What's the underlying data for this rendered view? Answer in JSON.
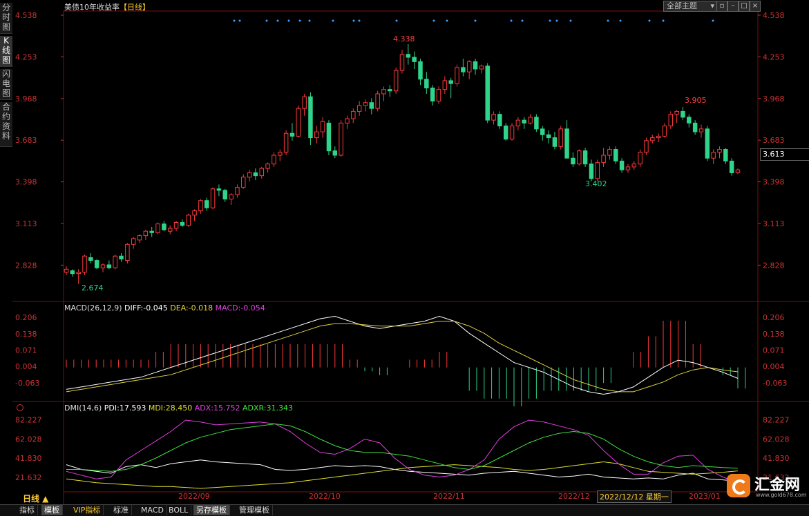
{
  "side_tabs": [
    "分时图",
    "K线图",
    "闪电图",
    "合约资料"
  ],
  "header": {
    "title": "美债10年收益率",
    "period": "【日线】",
    "theme_select": "全部主题"
  },
  "toolbar_icons": [
    "restore-icon",
    "minimize-icon",
    "maximize-icon",
    "close-icon"
  ],
  "price_panel": {
    "ylim": [
      2.674,
      4.538
    ],
    "y_ticks": [
      "4.538",
      "4.253",
      "3.968",
      "3.683",
      "3.398",
      "3.113",
      "2.828"
    ],
    "current_price": "3.613",
    "annotations": {
      "high": "4.338",
      "low": "2.674",
      "local_high": "3.905",
      "local_low": "3.402"
    }
  },
  "macd_panel": {
    "label": "MACD(26,12,9)",
    "diff": "DIFF:-0.045",
    "dea": "DEA:-0.018",
    "macd": "MACD:-0.054",
    "y_ticks": [
      "0.206",
      "0.138",
      "0.071",
      "0.004",
      "-0.063"
    ]
  },
  "dmi_panel": {
    "label": "DMI(14,6)",
    "pdi": "PDI:17.593",
    "mdi": "MDI:28.450",
    "adx": "ADX:15.752",
    "adxr": "ADXR:31.343",
    "y_ticks": [
      "82.227",
      "62.028",
      "41.830",
      "21.632"
    ]
  },
  "x_axis": {
    "period_label": "日线 ▲",
    "month_labels": [
      "2022/09",
      "2022/10",
      "2022/11",
      "2022/12",
      "2023/01"
    ],
    "cursor_date": "2022/12/12 星期一"
  },
  "bottom_tabs": [
    "指标",
    "模板",
    "VIP指标",
    "标准",
    "MACD",
    "BOLL",
    "另存模板",
    "管理模板"
  ],
  "logo": {
    "text": "汇金网",
    "url_text": "www.gold678.com"
  },
  "colors": {
    "up": "#ff3a3a",
    "down": "#2fd48a",
    "axis": "#cc3333",
    "diff": "#ffffff",
    "dea": "#e0d040",
    "pdi": "#ffffff",
    "mdi": "#e0e030",
    "adx": "#e040e0",
    "adxr": "#40e040"
  },
  "chart_data": [
    {
      "type": "candlestick",
      "title": "美债10年收益率",
      "ylim": [
        2.674,
        4.538
      ],
      "ohlc": [
        [
          2.78,
          2.82,
          2.76,
          2.8
        ],
        [
          2.79,
          2.8,
          2.75,
          2.77
        ],
        [
          2.77,
          2.8,
          2.7,
          2.78
        ],
        [
          2.78,
          2.9,
          2.76,
          2.89
        ],
        [
          2.88,
          2.91,
          2.84,
          2.86
        ],
        [
          2.86,
          2.87,
          2.8,
          2.81
        ],
        [
          2.81,
          2.84,
          2.78,
          2.83
        ],
        [
          2.83,
          2.86,
          2.8,
          2.81
        ],
        [
          2.81,
          2.9,
          2.8,
          2.89
        ],
        [
          2.89,
          2.91,
          2.85,
          2.87
        ],
        [
          2.86,
          2.98,
          2.84,
          2.97
        ],
        [
          2.97,
          3.02,
          2.94,
          3.01
        ],
        [
          3.0,
          3.04,
          2.98,
          3.03
        ],
        [
          3.03,
          3.07,
          3.0,
          3.06
        ],
        [
          3.06,
          3.09,
          3.02,
          3.05
        ],
        [
          3.05,
          3.12,
          3.04,
          3.11
        ],
        [
          3.11,
          3.13,
          3.06,
          3.07
        ],
        [
          3.06,
          3.1,
          3.04,
          3.08
        ],
        [
          3.08,
          3.13,
          3.06,
          3.12
        ],
        [
          3.12,
          3.14,
          3.09,
          3.1
        ],
        [
          3.1,
          3.18,
          3.09,
          3.17
        ],
        [
          3.17,
          3.21,
          3.13,
          3.2
        ],
        [
          3.2,
          3.28,
          3.18,
          3.27
        ],
        [
          3.27,
          3.29,
          3.2,
          3.22
        ],
        [
          3.22,
          3.36,
          3.21,
          3.35
        ],
        [
          3.35,
          3.38,
          3.3,
          3.34
        ],
        [
          3.34,
          3.35,
          3.26,
          3.28
        ],
        [
          3.28,
          3.32,
          3.24,
          3.31
        ],
        [
          3.31,
          3.38,
          3.29,
          3.36
        ],
        [
          3.36,
          3.45,
          3.35,
          3.43
        ],
        [
          3.43,
          3.48,
          3.4,
          3.46
        ],
        [
          3.46,
          3.49,
          3.41,
          3.44
        ],
        [
          3.44,
          3.5,
          3.42,
          3.49
        ],
        [
          3.49,
          3.53,
          3.46,
          3.52
        ],
        [
          3.52,
          3.6,
          3.5,
          3.58
        ],
        [
          3.58,
          3.62,
          3.54,
          3.6
        ],
        [
          3.6,
          3.75,
          3.58,
          3.73
        ],
        [
          3.73,
          3.8,
          3.68,
          3.71
        ],
        [
          3.71,
          3.92,
          3.7,
          3.9
        ],
        [
          3.9,
          4.0,
          3.85,
          3.98
        ],
        [
          3.98,
          4.01,
          3.65,
          3.7
        ],
        [
          3.7,
          3.78,
          3.66,
          3.74
        ],
        [
          3.74,
          3.84,
          3.7,
          3.81
        ],
        [
          3.8,
          3.82,
          3.58,
          3.61
        ],
        [
          3.61,
          3.64,
          3.56,
          3.58
        ],
        [
          3.58,
          3.82,
          3.57,
          3.8
        ],
        [
          3.8,
          3.85,
          3.76,
          3.83
        ],
        [
          3.83,
          3.9,
          3.8,
          3.88
        ],
        [
          3.88,
          3.95,
          3.85,
          3.92
        ],
        [
          3.92,
          3.96,
          3.88,
          3.94
        ],
        [
          3.94,
          3.97,
          3.86,
          3.9
        ],
        [
          3.9,
          4.02,
          3.88,
          4.0
        ],
        [
          4.0,
          4.05,
          3.95,
          4.03
        ],
        [
          4.03,
          4.06,
          3.98,
          4.02
        ],
        [
          4.02,
          4.18,
          4.0,
          4.16
        ],
        [
          4.16,
          4.3,
          4.14,
          4.27
        ],
        [
          4.27,
          4.34,
          4.2,
          4.25
        ],
        [
          4.25,
          4.29,
          4.17,
          4.22
        ],
        [
          4.22,
          4.24,
          4.06,
          4.1
        ],
        [
          4.1,
          4.15,
          4.0,
          4.04
        ],
        [
          4.04,
          4.06,
          3.92,
          3.95
        ],
        [
          3.95,
          4.05,
          3.93,
          4.03
        ],
        [
          4.03,
          4.12,
          4.0,
          4.09
        ],
        [
          4.09,
          4.11,
          3.97,
          4.07
        ],
        [
          4.07,
          4.2,
          4.05,
          4.18
        ],
        [
          4.18,
          4.24,
          4.12,
          4.15
        ],
        [
          4.15,
          4.23,
          4.1,
          4.22
        ],
        [
          4.22,
          4.24,
          4.13,
          4.17
        ],
        [
          4.17,
          4.2,
          4.14,
          4.19
        ],
        [
          4.19,
          4.21,
          3.8,
          3.82
        ],
        [
          3.82,
          3.88,
          3.79,
          3.86
        ],
        [
          3.86,
          3.88,
          3.76,
          3.78
        ],
        [
          3.78,
          3.8,
          3.68,
          3.69
        ],
        [
          3.69,
          3.8,
          3.68,
          3.78
        ],
        [
          3.78,
          3.84,
          3.75,
          3.82
        ],
        [
          3.82,
          3.84,
          3.76,
          3.8
        ],
        [
          3.8,
          3.86,
          3.79,
          3.84
        ],
        [
          3.84,
          3.86,
          3.74,
          3.76
        ],
        [
          3.76,
          3.78,
          3.68,
          3.72
        ],
        [
          3.72,
          3.75,
          3.66,
          3.7
        ],
        [
          3.7,
          3.74,
          3.62,
          3.64
        ],
        [
          3.64,
          3.78,
          3.62,
          3.76
        ],
        [
          3.76,
          3.82,
          3.62,
          3.56
        ],
        [
          3.56,
          3.6,
          3.5,
          3.52
        ],
        [
          3.52,
          3.62,
          3.51,
          3.61
        ],
        [
          3.61,
          3.63,
          3.5,
          3.52
        ],
        [
          3.52,
          3.55,
          3.4,
          3.42
        ],
        [
          3.42,
          3.55,
          3.4,
          3.53
        ],
        [
          3.53,
          3.63,
          3.5,
          3.58
        ],
        [
          3.58,
          3.64,
          3.55,
          3.62
        ],
        [
          3.62,
          3.64,
          3.52,
          3.54
        ],
        [
          3.54,
          3.56,
          3.46,
          3.48
        ],
        [
          3.48,
          3.52,
          3.46,
          3.5
        ],
        [
          3.5,
          3.54,
          3.48,
          3.52
        ],
        [
          3.52,
          3.62,
          3.5,
          3.6
        ],
        [
          3.6,
          3.7,
          3.58,
          3.68
        ],
        [
          3.68,
          3.72,
          3.66,
          3.7
        ],
        [
          3.7,
          3.73,
          3.67,
          3.71
        ],
        [
          3.71,
          3.8,
          3.7,
          3.78
        ],
        [
          3.78,
          3.88,
          3.76,
          3.86
        ],
        [
          3.86,
          3.89,
          3.8,
          3.88
        ],
        [
          3.88,
          3.91,
          3.82,
          3.84
        ],
        [
          3.84,
          3.86,
          3.77,
          3.8
        ],
        [
          3.8,
          3.82,
          3.72,
          3.74
        ],
        [
          3.74,
          3.79,
          3.7,
          3.76
        ],
        [
          3.76,
          3.78,
          3.54,
          3.56
        ],
        [
          3.56,
          3.62,
          3.52,
          3.6
        ],
        [
          3.6,
          3.64,
          3.56,
          3.62
        ],
        [
          3.62,
          3.63,
          3.52,
          3.54
        ],
        [
          3.54,
          3.56,
          3.44,
          3.46
        ],
        [
          3.46,
          3.49,
          3.45,
          3.48
        ]
      ]
    },
    {
      "type": "line",
      "title": "MACD(26,12,9)",
      "ylim": [
        -0.12,
        0.22
      ],
      "series": [
        {
          "name": "DIFF",
          "values": [
            -0.09,
            -0.08,
            -0.07,
            -0.06,
            -0.05,
            -0.04,
            -0.02,
            0.0,
            0.02,
            0.04,
            0.06,
            0.08,
            0.1,
            0.12,
            0.14,
            0.16,
            0.18,
            0.2,
            0.21,
            0.19,
            0.17,
            0.16,
            0.17,
            0.18,
            0.19,
            0.21,
            0.19,
            0.14,
            0.1,
            0.06,
            0.02,
            0.0,
            -0.02,
            -0.05,
            -0.08,
            -0.1,
            -0.11,
            -0.1,
            -0.08,
            -0.04,
            0.0,
            0.03,
            0.02,
            0.0,
            -0.02,
            -0.045
          ]
        },
        {
          "name": "DEA",
          "values": [
            -0.1,
            -0.09,
            -0.08,
            -0.07,
            -0.06,
            -0.05,
            -0.04,
            -0.03,
            -0.01,
            0.01,
            0.03,
            0.05,
            0.07,
            0.09,
            0.11,
            0.13,
            0.15,
            0.17,
            0.18,
            0.18,
            0.175,
            0.17,
            0.17,
            0.17,
            0.18,
            0.19,
            0.19,
            0.17,
            0.14,
            0.1,
            0.07,
            0.04,
            0.01,
            -0.02,
            -0.05,
            -0.07,
            -0.09,
            -0.1,
            -0.1,
            -0.08,
            -0.06,
            -0.03,
            -0.01,
            0.0,
            -0.01,
            -0.018
          ]
        }
      ]
    },
    {
      "type": "line",
      "title": "DMI(14,6)",
      "ylim": [
        10,
        90
      ],
      "series": [
        {
          "name": "PDI",
          "values": [
            35,
            30,
            28,
            26,
            33,
            35,
            32,
            36,
            38,
            40,
            38,
            37,
            36,
            35,
            30,
            29,
            30,
            32,
            34,
            33,
            34,
            33,
            30,
            28,
            27,
            26,
            25,
            24,
            26,
            27,
            28,
            26,
            24,
            22,
            23,
            25,
            22,
            21,
            20,
            21,
            20,
            24,
            26,
            20,
            19,
            17.593
          ]
        },
        {
          "name": "MDI",
          "values": [
            20,
            18,
            16,
            15,
            14,
            13,
            12,
            12,
            11,
            10,
            11,
            12,
            13,
            14,
            15,
            16,
            18,
            20,
            22,
            24,
            26,
            28,
            30,
            32,
            33,
            34,
            35,
            34,
            33,
            32,
            30,
            29,
            30,
            32,
            34,
            36,
            38,
            36,
            32,
            28,
            27,
            26,
            25,
            26,
            27,
            28.45
          ]
        },
        {
          "name": "ADX",
          "values": [
            28,
            24,
            20,
            22,
            40,
            50,
            60,
            70,
            82,
            80,
            77,
            78,
            79,
            80,
            78,
            70,
            58,
            48,
            46,
            52,
            62,
            58,
            42,
            30,
            24,
            22,
            24,
            30,
            40,
            62,
            75,
            82,
            80,
            76,
            72,
            66,
            50,
            36,
            25,
            25,
            37,
            44,
            45,
            30,
            22,
            15.752
          ]
        },
        {
          "name": "ADXR",
          "values": [
            30,
            30,
            29,
            28,
            30,
            35,
            42,
            50,
            58,
            64,
            68,
            72,
            74,
            76,
            78,
            76,
            70,
            62,
            55,
            50,
            48,
            48,
            46,
            44,
            40,
            36,
            32,
            30,
            34,
            42,
            50,
            58,
            64,
            68,
            70,
            68,
            62,
            52,
            44,
            38,
            34,
            32,
            34,
            33,
            32,
            31.343
          ]
        }
      ]
    }
  ]
}
